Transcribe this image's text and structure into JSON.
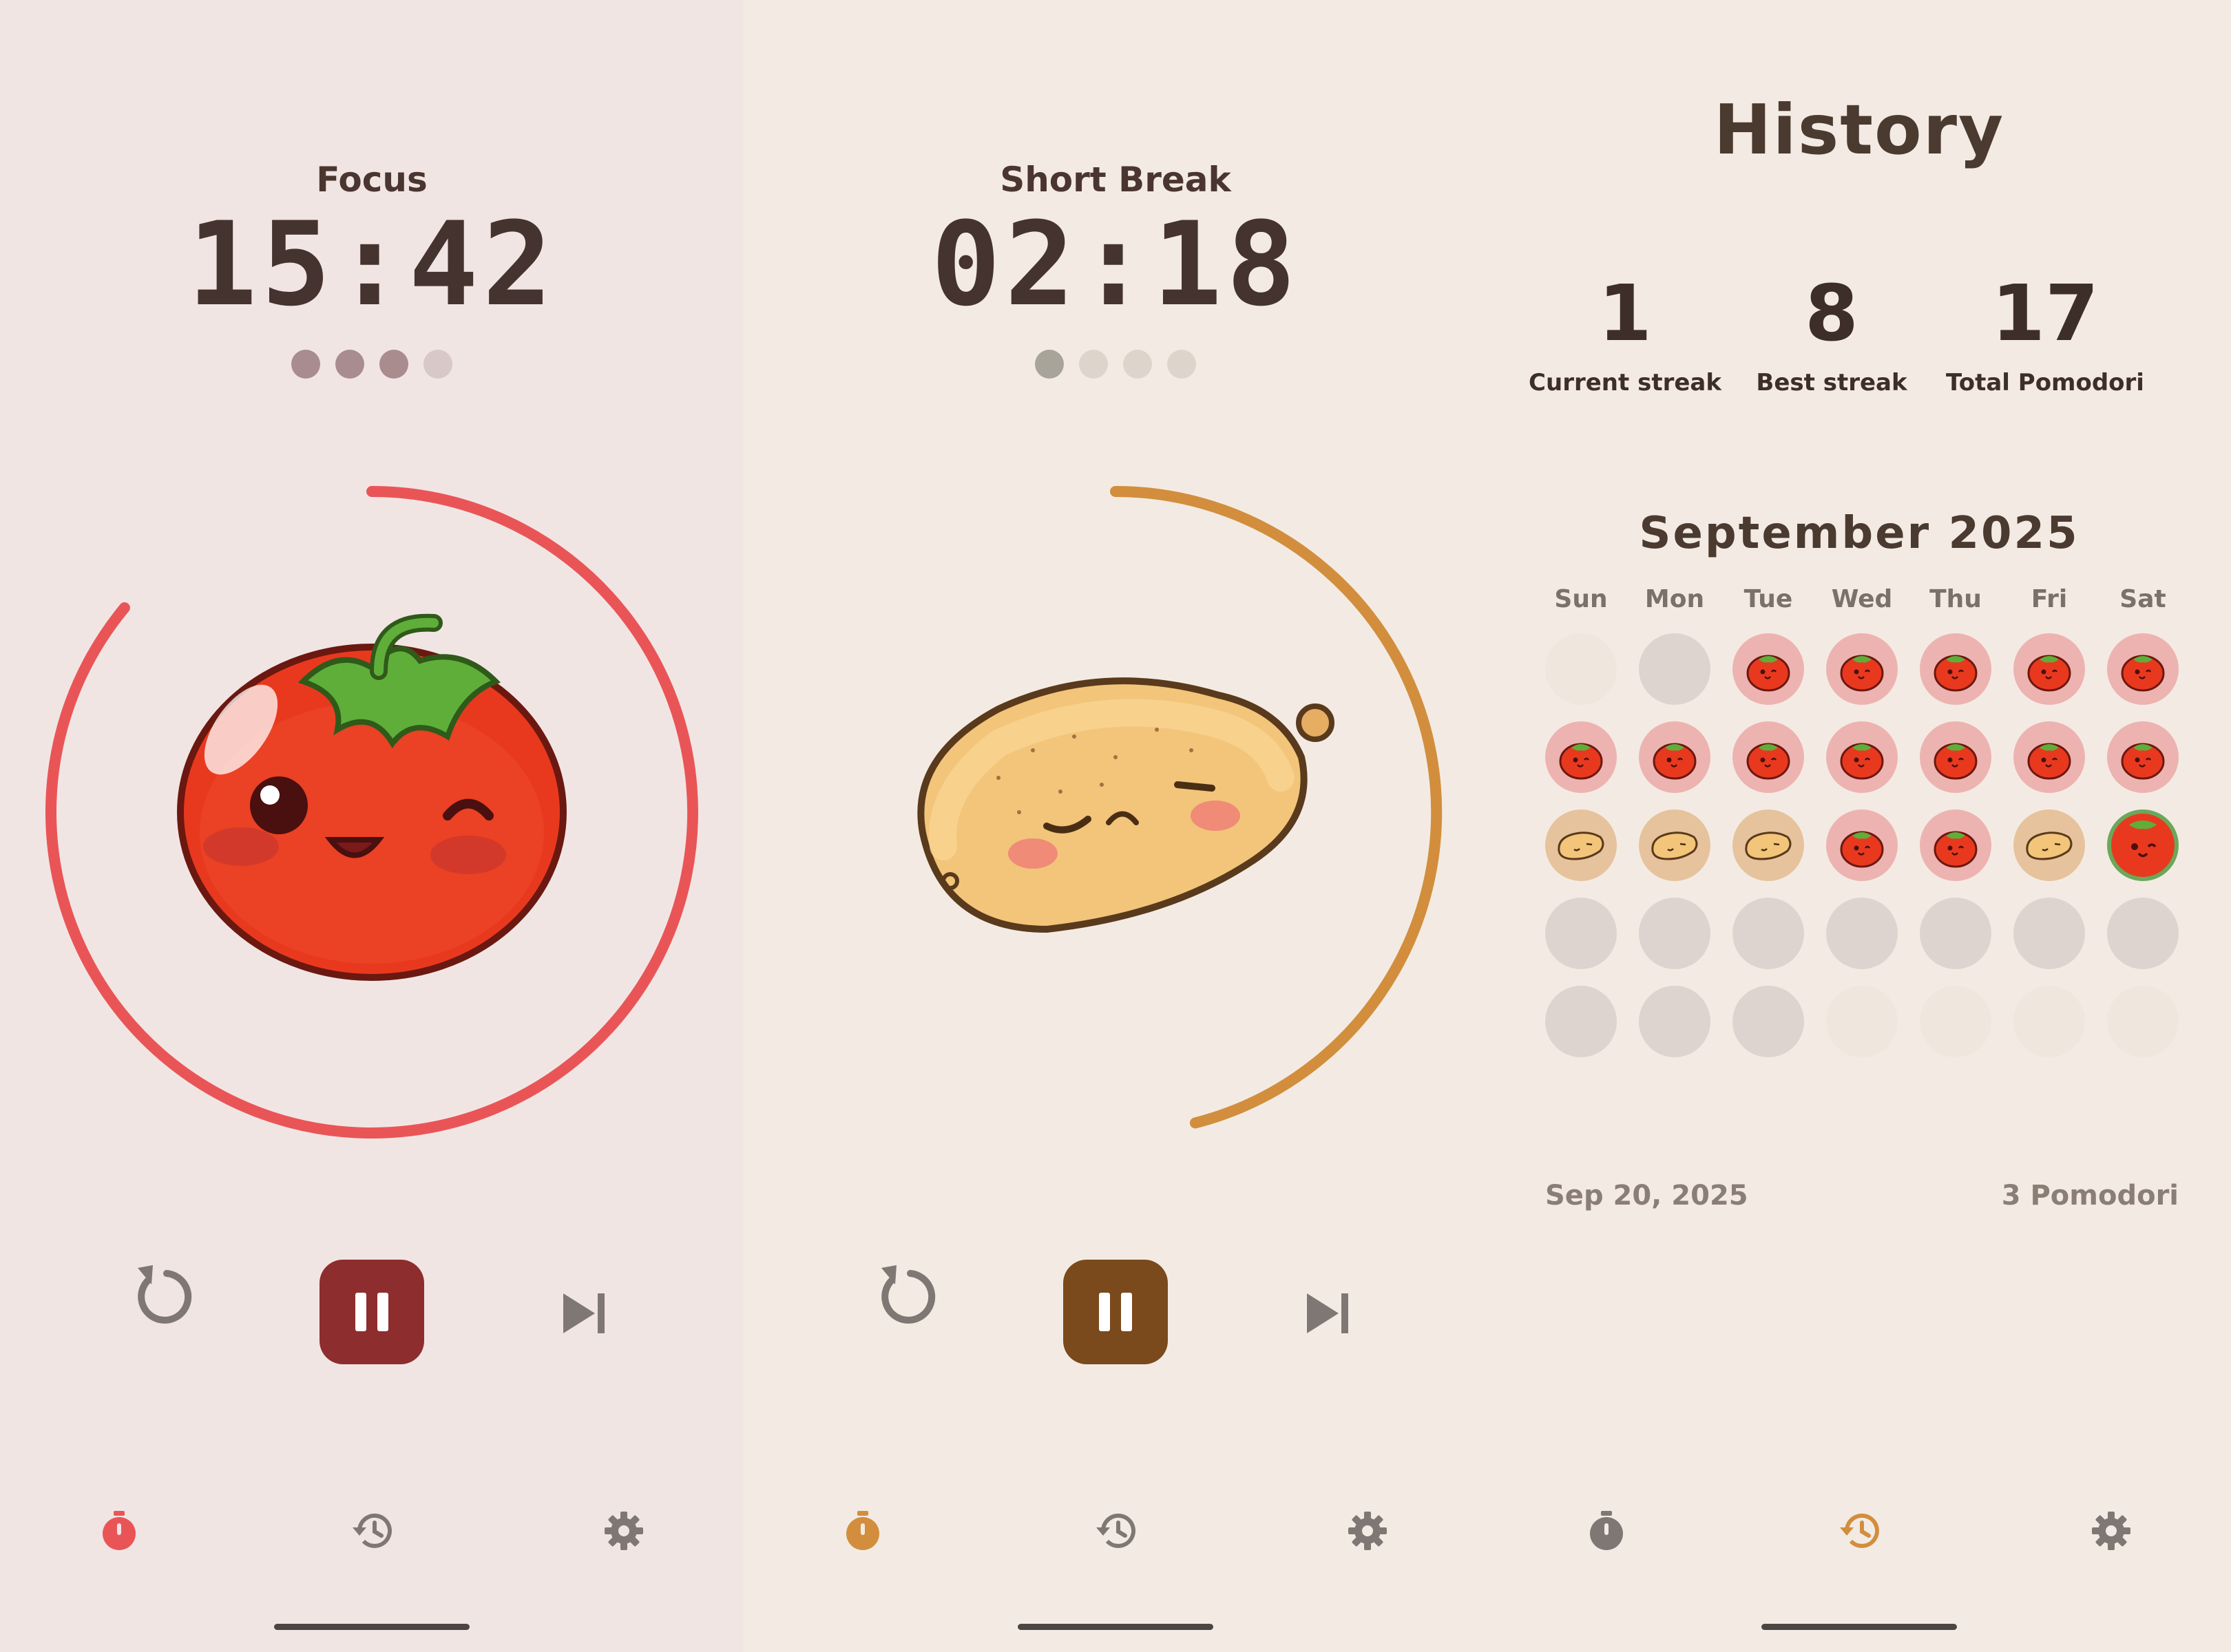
{
  "colors": {
    "tomato": "#E95556",
    "potato": "#D28E3D",
    "focus_pause": "#8E2D2D",
    "break_pause": "#7A4A1C",
    "nav_inactive": "#7F7773",
    "tomato_day_bg": "#EDB3B1",
    "potato_day_bg": "#E6C39D",
    "empty_day_bg": "#DDD4CF"
  },
  "focus_screen": {
    "label": "Focus",
    "timer": "15:42",
    "session_dots_completed": 3,
    "session_dots_total": 4,
    "progress": 0.86,
    "mascot_icon": "tomato-mascot-icon",
    "controls": {
      "reset_icon": "reset-icon",
      "pause_icon": "pause-icon",
      "skip_icon": "skip-icon"
    },
    "nav": {
      "active": "timer",
      "items": [
        "timer-icon",
        "history-icon",
        "settings-icon"
      ]
    }
  },
  "break_screen": {
    "label": "Short Break",
    "timer": "02:18",
    "session_dots_completed": 1,
    "session_dots_total": 4,
    "progress": 0.46,
    "mascot_icon": "potato-mascot-icon",
    "controls": {
      "reset_icon": "reset-icon",
      "pause_icon": "pause-icon",
      "skip_icon": "skip-icon"
    },
    "nav": {
      "active": "timer",
      "items": [
        "timer-icon",
        "history-icon",
        "settings-icon"
      ]
    }
  },
  "history_screen": {
    "title": "History",
    "stats": [
      {
        "value": "1",
        "label": "Current streak"
      },
      {
        "value": "8",
        "label": "Best streak"
      },
      {
        "value": "17",
        "label": "Total Pomodori"
      }
    ],
    "month_label": "September 2025",
    "weekdays": [
      "Sun",
      "Mon",
      "Tue",
      "Wed",
      "Thu",
      "Fri",
      "Sat"
    ],
    "calendar_rows": [
      [
        "blank",
        "empty",
        "tomato",
        "tomato",
        "tomato",
        "tomato",
        "tomato"
      ],
      [
        "tomato",
        "tomato",
        "tomato",
        "tomato",
        "tomato",
        "tomato",
        "tomato"
      ],
      [
        "potato",
        "potato",
        "potato",
        "tomato",
        "tomato",
        "potato",
        "selected"
      ],
      [
        "empty",
        "empty",
        "empty",
        "empty",
        "empty",
        "empty",
        "empty"
      ],
      [
        "empty",
        "empty",
        "empty",
        "blank",
        "blank",
        "blank",
        "blank"
      ]
    ],
    "selected_date": "Sep 20, 2025",
    "selected_count": "3 Pomodori",
    "nav": {
      "active": "history",
      "items": [
        "timer-icon",
        "history-icon",
        "settings-icon"
      ]
    }
  }
}
